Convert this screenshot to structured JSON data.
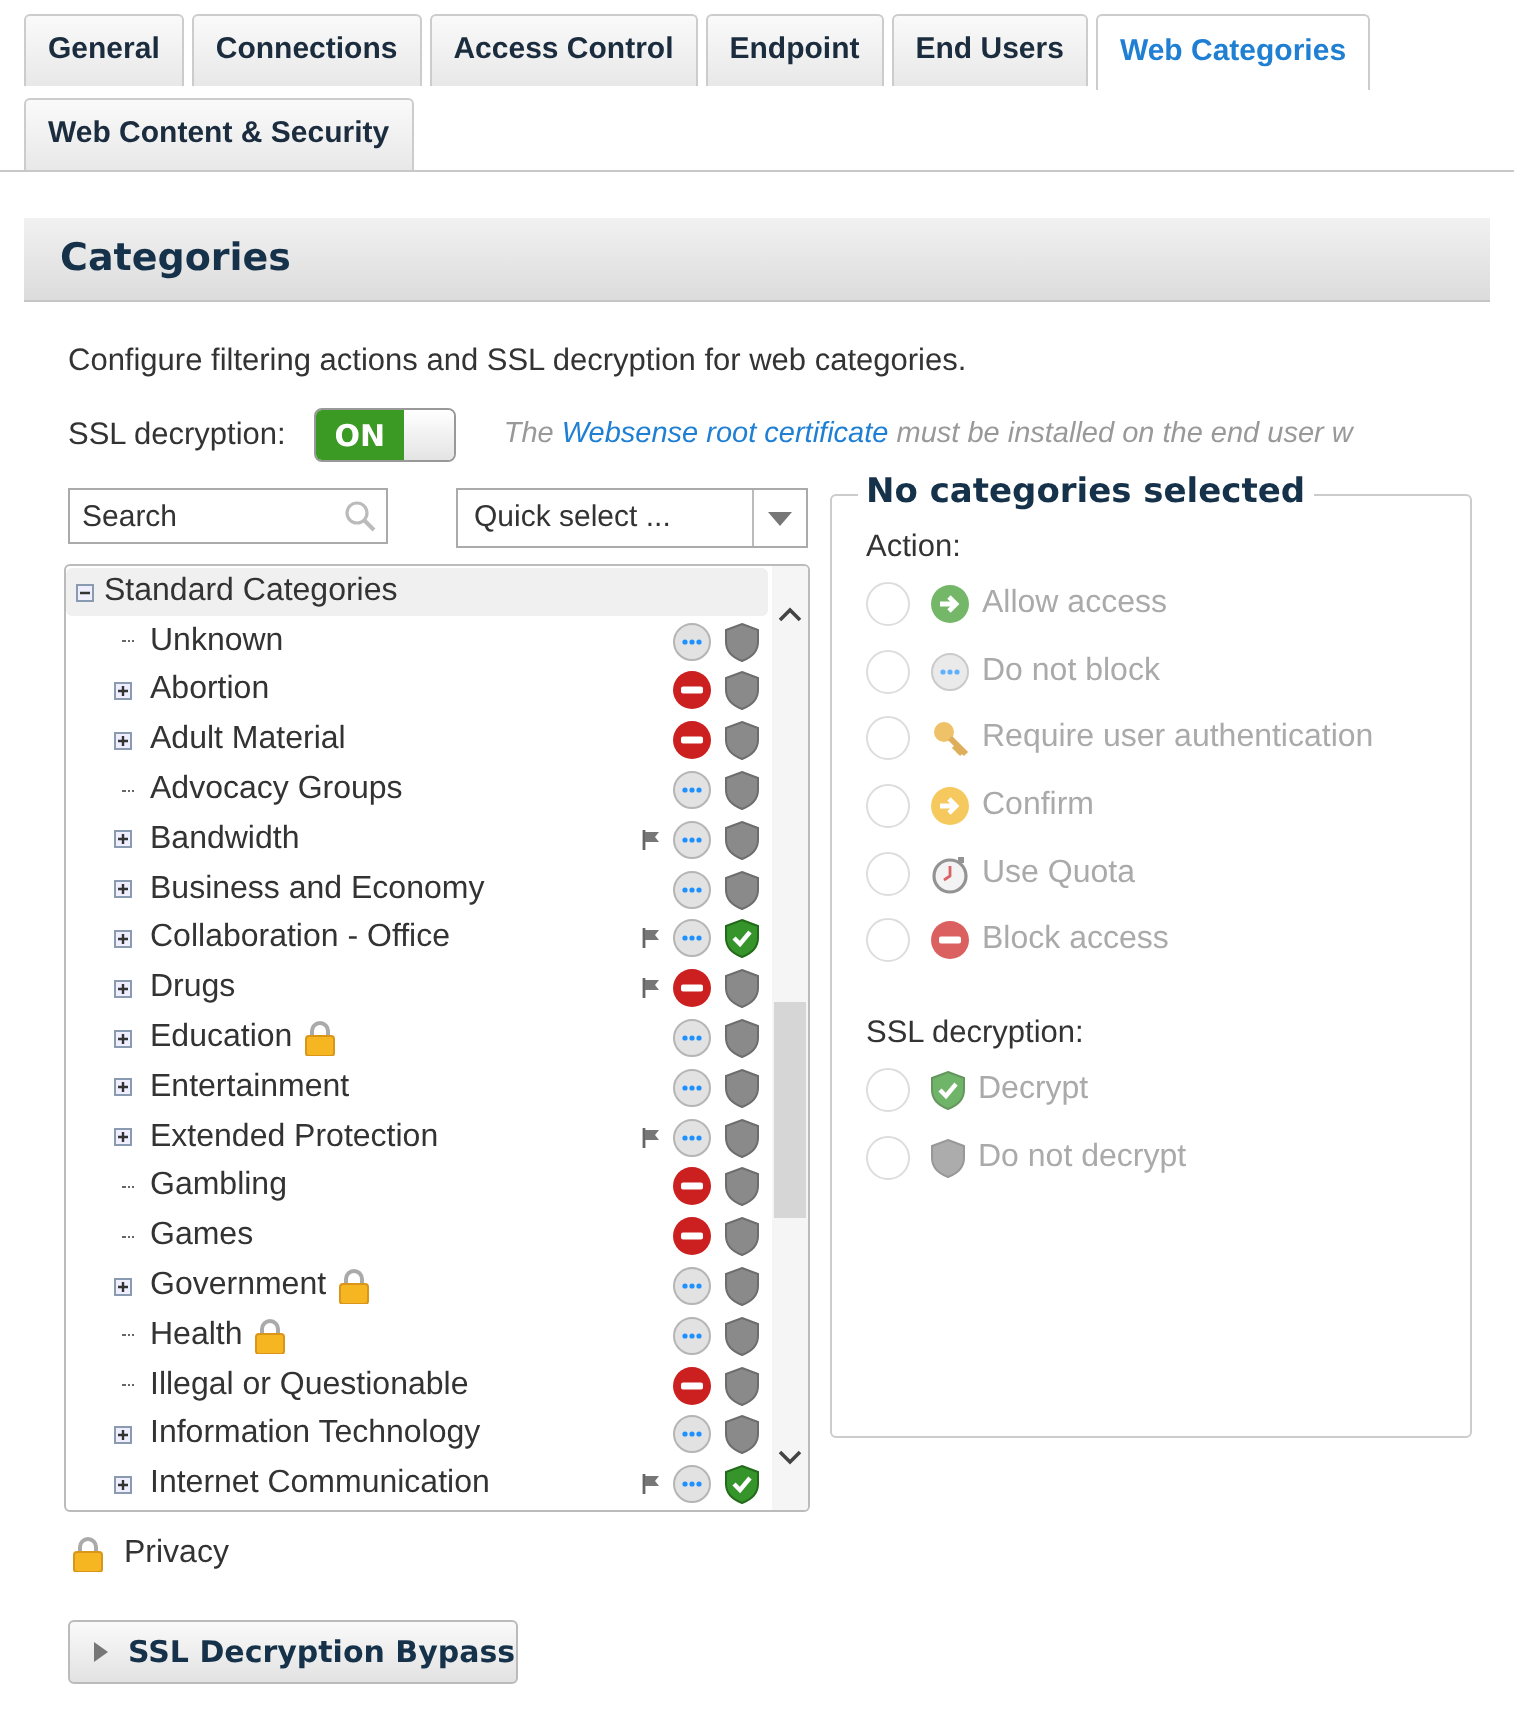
{
  "tabs": [
    {
      "label": "General",
      "selected": false
    },
    {
      "label": "Connections",
      "selected": false
    },
    {
      "label": "Access Control",
      "selected": false
    },
    {
      "label": "Endpoint",
      "selected": false
    },
    {
      "label": "End Users",
      "selected": false
    },
    {
      "label": "Web Categories",
      "selected": true
    },
    {
      "label": "Web Content & Security",
      "selected": false
    }
  ],
  "section": {
    "title": "Categories",
    "description": "Configure filtering actions and SSL decryption for web categories.",
    "ssl_toggle": {
      "label": "SSL decryption:",
      "on": true,
      "on_text": "ON"
    },
    "note": {
      "before": "The ",
      "link": "Websense root certificate",
      "after": " must be installed on the end user w"
    }
  },
  "search": {
    "placeholder": "Search"
  },
  "quick_select": {
    "placeholder": "Quick select ..."
  },
  "tree": {
    "label": "Standard Categories",
    "expanded": true,
    "children": [
      {
        "label": "Unknown",
        "expandable": false,
        "blocked": false,
        "flag": false,
        "decrypt": false,
        "locked": false
      },
      {
        "label": "Abortion",
        "expandable": true,
        "blocked": true,
        "flag": false,
        "decrypt": false,
        "locked": false
      },
      {
        "label": "Adult Material",
        "expandable": true,
        "blocked": true,
        "flag": false,
        "decrypt": false,
        "locked": false
      },
      {
        "label": "Advocacy Groups",
        "expandable": false,
        "blocked": false,
        "flag": false,
        "decrypt": false,
        "locked": false
      },
      {
        "label": "Bandwidth",
        "expandable": true,
        "blocked": false,
        "flag": true,
        "decrypt": false,
        "locked": false
      },
      {
        "label": "Business and Economy",
        "expandable": true,
        "blocked": false,
        "flag": false,
        "decrypt": false,
        "locked": false
      },
      {
        "label": "Collaboration - Office",
        "expandable": true,
        "blocked": false,
        "flag": true,
        "decrypt": true,
        "locked": false
      },
      {
        "label": "Drugs",
        "expandable": true,
        "blocked": true,
        "flag": true,
        "decrypt": false,
        "locked": false
      },
      {
        "label": "Education",
        "expandable": true,
        "blocked": false,
        "flag": false,
        "decrypt": false,
        "locked": true
      },
      {
        "label": "Entertainment",
        "expandable": true,
        "blocked": false,
        "flag": false,
        "decrypt": false,
        "locked": false
      },
      {
        "label": "Extended Protection",
        "expandable": true,
        "blocked": false,
        "flag": true,
        "decrypt": false,
        "locked": false
      },
      {
        "label": "Gambling",
        "expandable": false,
        "blocked": true,
        "flag": false,
        "decrypt": false,
        "locked": false
      },
      {
        "label": "Games",
        "expandable": false,
        "blocked": true,
        "flag": false,
        "decrypt": false,
        "locked": false
      },
      {
        "label": "Government",
        "expandable": true,
        "blocked": false,
        "flag": false,
        "decrypt": false,
        "locked": true
      },
      {
        "label": "Health",
        "expandable": false,
        "blocked": false,
        "flag": false,
        "decrypt": false,
        "locked": true
      },
      {
        "label": "Illegal or Questionable",
        "expandable": false,
        "blocked": true,
        "flag": false,
        "decrypt": false,
        "locked": false
      },
      {
        "label": "Information Technology",
        "expandable": true,
        "blocked": false,
        "flag": false,
        "decrypt": false,
        "locked": false
      },
      {
        "label": "Internet Communication",
        "expandable": true,
        "blocked": false,
        "flag": true,
        "decrypt": true,
        "locked": false
      }
    ]
  },
  "legend": {
    "label": "Privacy",
    "locked": true
  },
  "panel": {
    "title": "No categories selected",
    "action_label": "Action:",
    "actions": [
      {
        "label": "Allow access",
        "kind": "allow",
        "selected": false,
        "disabled": true
      },
      {
        "label": "Do not block",
        "kind": "permit",
        "selected": false,
        "disabled": true
      },
      {
        "label": "Require user authentication",
        "kind": "key",
        "selected": false,
        "disabled": true
      },
      {
        "label": "Confirm",
        "kind": "confirm",
        "selected": false,
        "disabled": true
      },
      {
        "label": "Use Quota",
        "kind": "quota",
        "selected": false,
        "disabled": true
      },
      {
        "label": "Block access",
        "kind": "block",
        "selected": false,
        "disabled": true
      }
    ],
    "ssl_label": "SSL decryption:",
    "ssl_options": [
      {
        "label": "Decrypt",
        "kind": "decrypt",
        "selected": false,
        "disabled": true
      },
      {
        "label": "Do not decrypt",
        "kind": "nodecrypt",
        "selected": false,
        "disabled": true
      }
    ]
  },
  "bypass_button": {
    "label": "SSL Decryption Bypass",
    "expanded": false
  }
}
